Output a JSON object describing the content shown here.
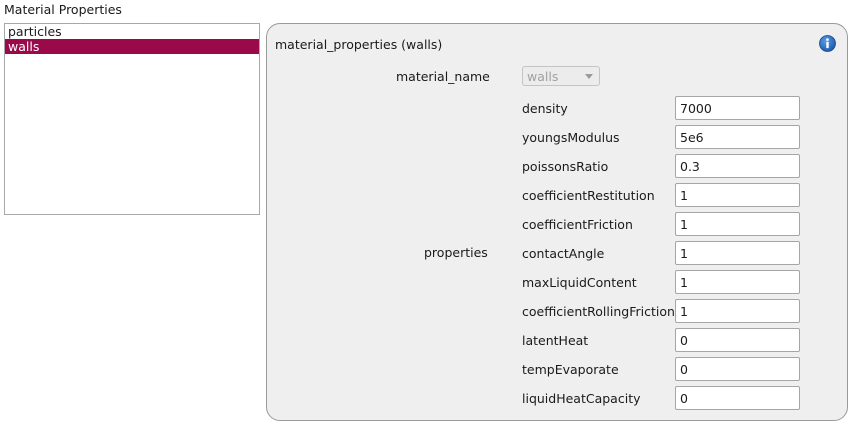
{
  "section_title": "Material Properties",
  "materials_list": [
    {
      "label": "particles",
      "selected": false
    },
    {
      "label": "walls",
      "selected": true
    }
  ],
  "panel": {
    "title": "material_properties (walls)",
    "info_icon": "info-icon",
    "material_name_label": "material_name",
    "material_name_value": "walls",
    "properties_label": "properties",
    "properties": [
      {
        "name": "density",
        "value": "7000"
      },
      {
        "name": "youngsModulus",
        "value": "5e6"
      },
      {
        "name": "poissonsRatio",
        "value": "0.3"
      },
      {
        "name": "coefficientRestitution",
        "value": "1"
      },
      {
        "name": "coefficientFriction",
        "value": "1"
      },
      {
        "name": "contactAngle",
        "value": "1"
      },
      {
        "name": "maxLiquidContent",
        "value": "1"
      },
      {
        "name": "coefficientRollingFriction",
        "value": "1"
      },
      {
        "name": "latentHeat",
        "value": "0"
      },
      {
        "name": "tempEvaporate",
        "value": "0"
      },
      {
        "name": "liquidHeatCapacity",
        "value": "0"
      }
    ]
  },
  "colors": {
    "selection": "#9a0a4a",
    "info_icon": "#1f63b5"
  }
}
